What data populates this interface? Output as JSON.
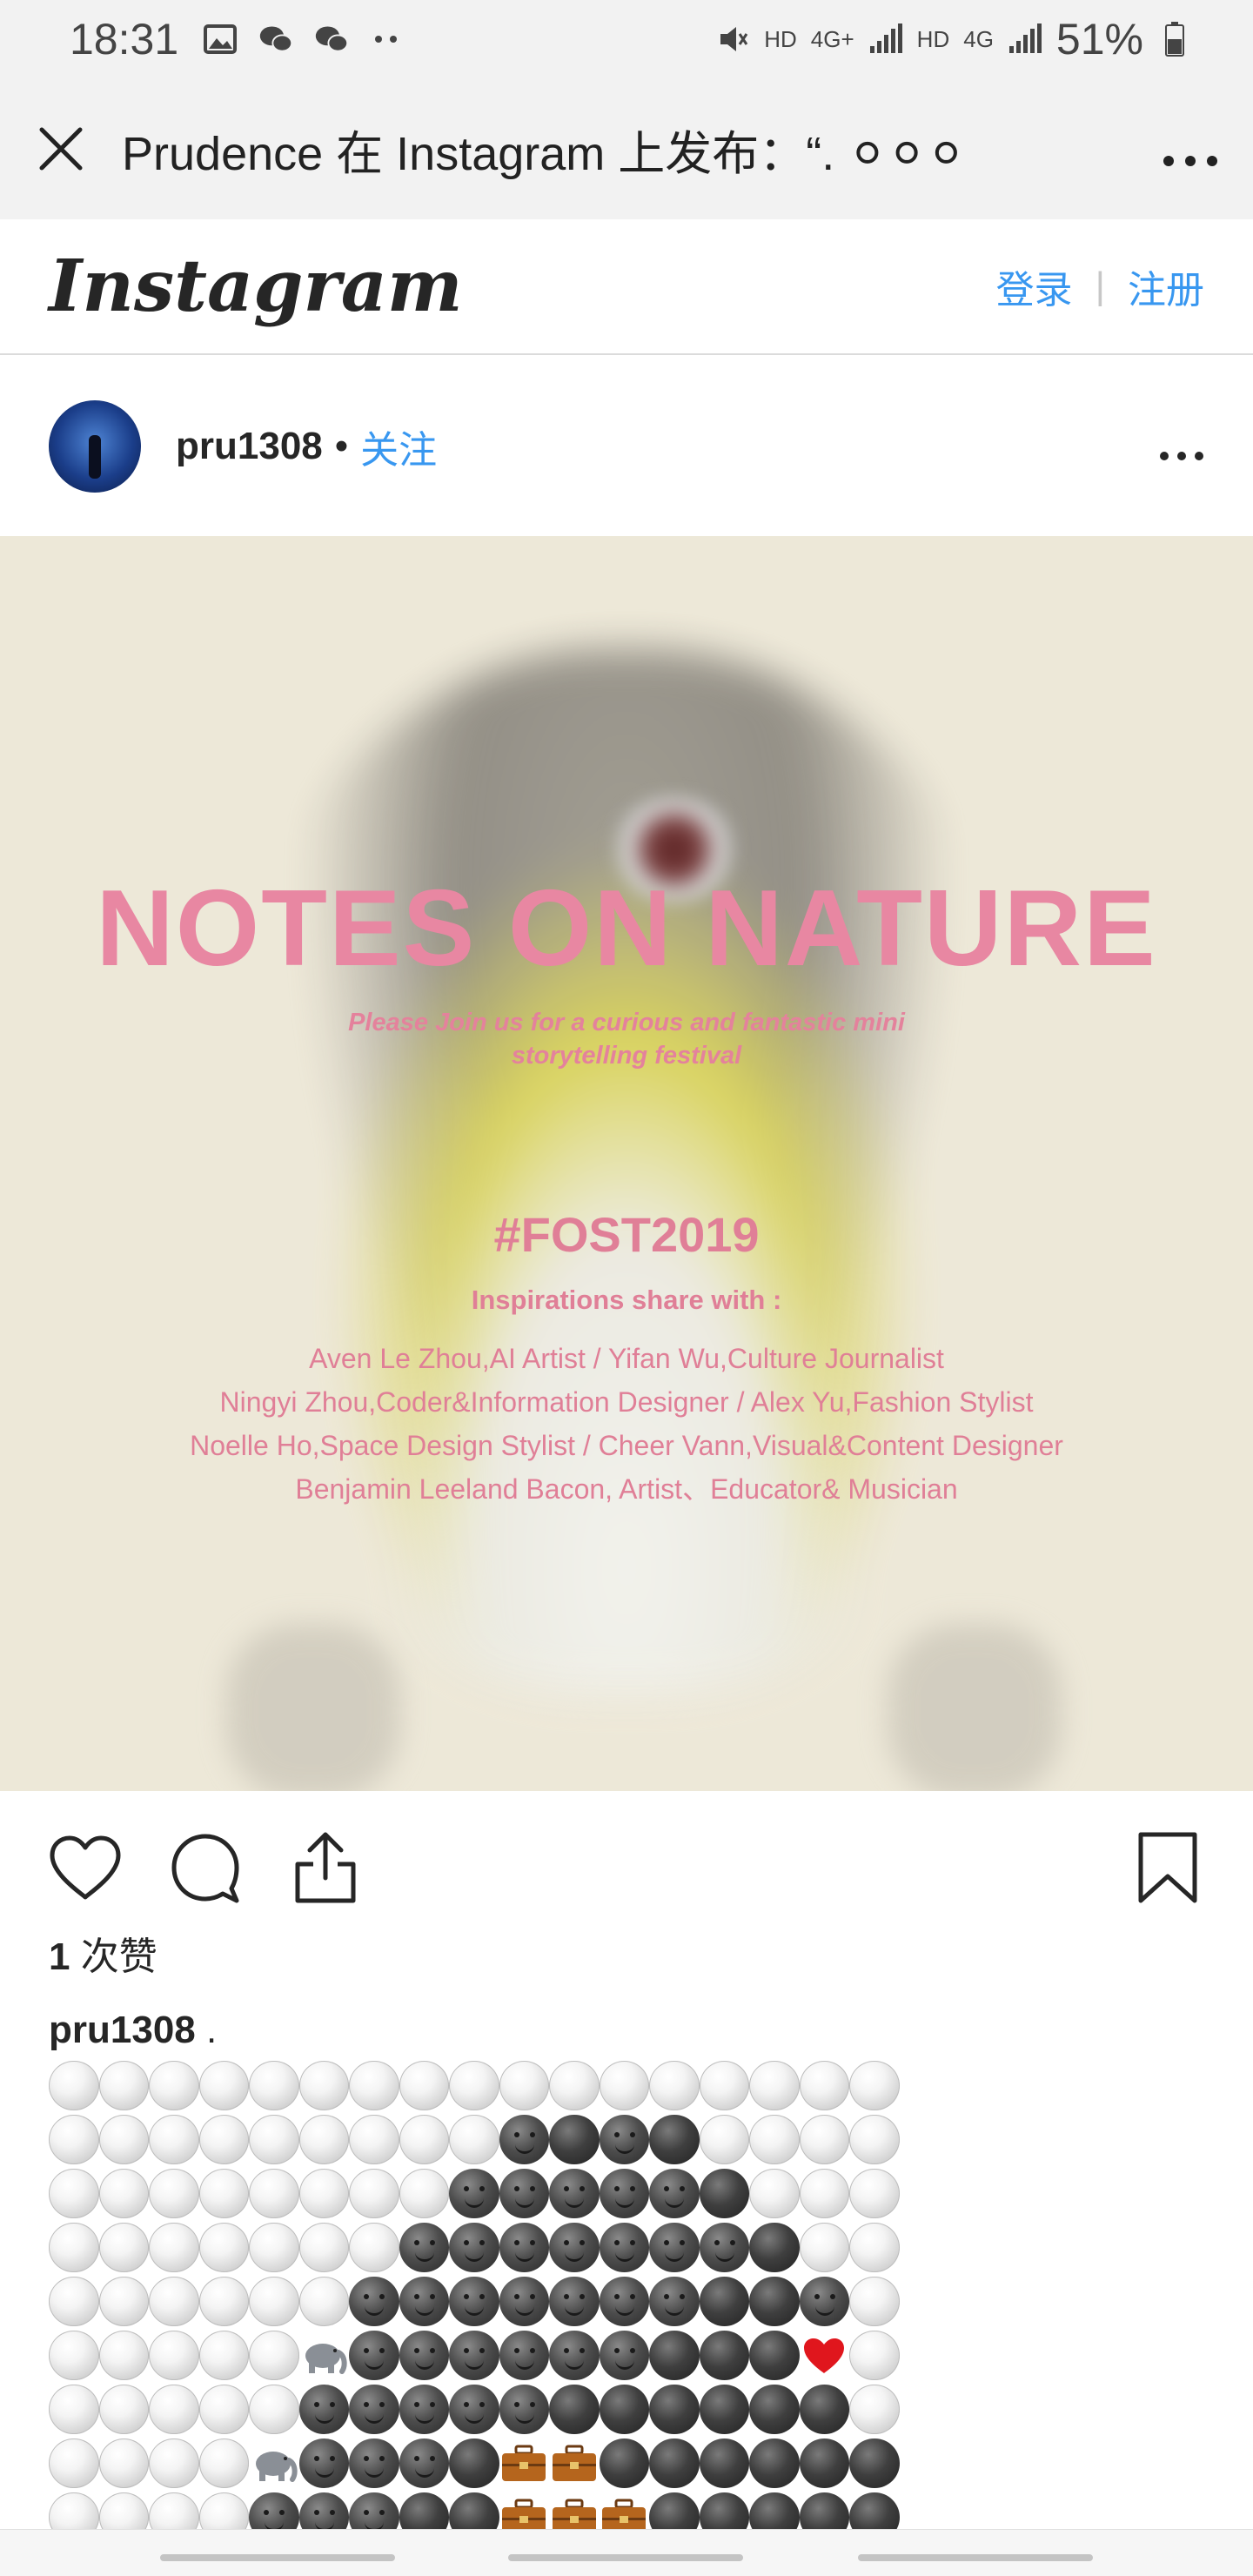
{
  "status_bar": {
    "time": "18:31",
    "network_labels": [
      "HD",
      "4G+",
      "HD",
      "4G"
    ],
    "battery": "51%"
  },
  "browser": {
    "title": "Prudence 在 Instagram 上发布：“. ⚪⚪⚪",
    "close_icon": "close-icon",
    "more_icon": "more-horizontal-icon"
  },
  "instagram": {
    "logo": "Instagram",
    "login": "登录",
    "separator": "|",
    "signup": "注册"
  },
  "post": {
    "username": "pru1308",
    "dot": "•",
    "follow": "关注",
    "image": {
      "title": "NOTES ON NATURE",
      "subtitle_line1": "Please Join us for a  curious and fantastic mini",
      "subtitle_line2": "storytelling  festival",
      "hashtag": "#FOST2019",
      "inspirations": "Inspirations share with :",
      "lines": [
        "Aven Le Zhou,AI Artist / Yifan Wu,Culture Journalist",
        "Ningyi Zhou,Coder&Information Designer / Alex Yu,Fashion Stylist",
        "Noelle Ho,Space Design Stylist / Cheer Vann,Visual&Content Designer",
        "Benjamin Leeland Bacon, Artist、Educator& Musician"
      ]
    },
    "likes_count": "1",
    "likes_label": " 次赞",
    "caption_user": "pru1308",
    "caption_text": " .",
    "emoji_rows": [
      "WWWWWWWWWWWWWWWWW",
      "WWWWWWWWWFDFDWWWW",
      "WWWWWWWWFFFFFDWWW",
      "WWWWWWWFFFFFFFDWW",
      "WWWWWWFFFFFFFDDFW",
      "WWWWWEFFFFFFDDDHW",
      "WWWWWFFFFFDDDDDDW",
      "WWWWEFFFDCCDDDDDD",
      "WWWWFFFDDCCCDDDDD"
    ]
  },
  "colors": {
    "link_blue": "#3897f0",
    "poster_pink": "#e887a2",
    "poster_bg": "#ede8d8"
  }
}
